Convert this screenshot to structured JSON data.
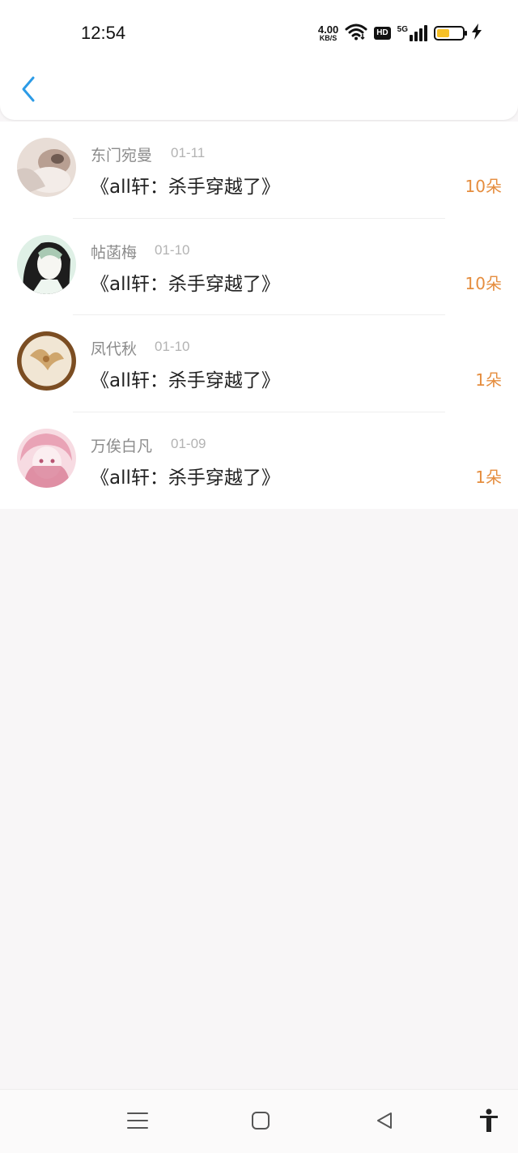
{
  "status_bar": {
    "time": "12:54",
    "speed_value": "4.00",
    "speed_unit": "KB/S",
    "hd_label": "HD",
    "network_label": "5G",
    "battery_level": 0.45,
    "icons": [
      "wifi-icon",
      "hd-icon",
      "signal-5g-icon",
      "battery-icon",
      "charging-icon"
    ]
  },
  "nav": {
    "back_icon": "chevron-left-icon"
  },
  "list": {
    "items": [
      {
        "name": "东门宛曼",
        "date": "01-11",
        "title": "《all轩：杀手穿越了》",
        "amount": "10朵",
        "avatar_colors": [
          "#e8ddd6",
          "#b89f92",
          "#6e5a51"
        ]
      },
      {
        "name": "帖菡梅",
        "date": "01-10",
        "title": "《all轩：杀手穿越了》",
        "amount": "10朵",
        "avatar_colors": [
          "#dff0e6",
          "#1d1d1d",
          "#a9c9b3"
        ]
      },
      {
        "name": "凤代秋",
        "date": "01-10",
        "title": "《all轩：杀手穿越了》",
        "amount": "1朵",
        "avatar_colors": [
          "#f1e6d4",
          "#c99a5a",
          "#7b4d22"
        ]
      },
      {
        "name": "万俟白凡",
        "date": "01-09",
        "title": "《all轩：杀手穿越了》",
        "amount": "1朵",
        "avatar_colors": [
          "#f7dbe2",
          "#e9a3b6",
          "#d46f8a"
        ]
      }
    ]
  },
  "bottom_nav": {
    "icons": [
      "menu-icon",
      "home-square-icon",
      "back-triangle-icon",
      "accessibility-icon"
    ]
  },
  "colors": {
    "accent_blue": "#2c9be6",
    "amount_orange": "#e58d3e",
    "name_gray": "#8b8b8b",
    "date_gray": "#b3b3b3",
    "battery_yellow": "#f6c026"
  }
}
